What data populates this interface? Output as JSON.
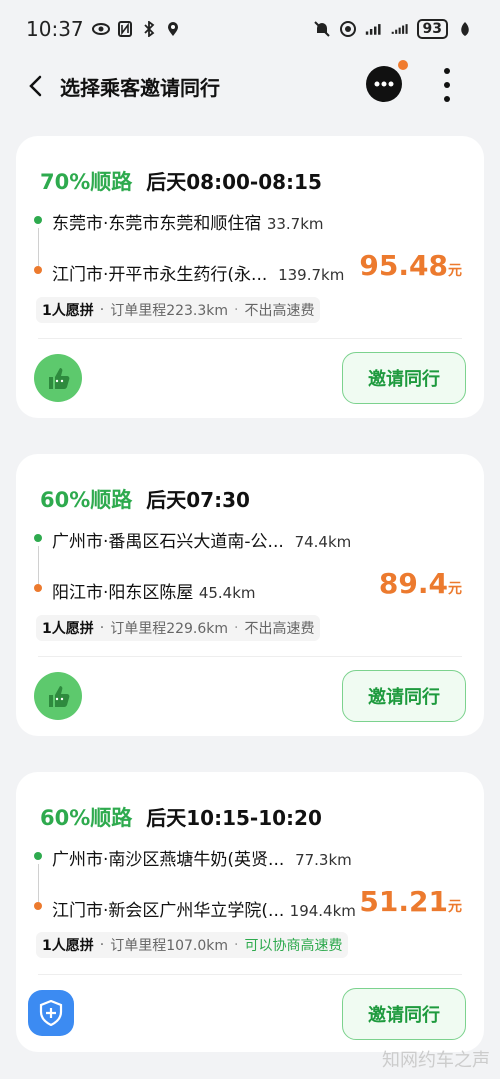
{
  "status": {
    "time": "10:37",
    "battery": "93"
  },
  "header": {
    "title": "选择乘客邀请同行"
  },
  "cards": [
    {
      "match": "70%顺路",
      "time": "后天08:00-08:15",
      "from_addr": "东莞市·东莞市东莞和顺住宿",
      "from_dist": "33.7km",
      "to_addr": "江门市·开平市永生药行(永...",
      "to_dist": "139.7km",
      "price": "95.48",
      "price_unit": "元",
      "riders": "1人愿拼",
      "order_distance": "订单里程223.3km",
      "toll": "不出高速费",
      "invite_label": "邀请同行"
    },
    {
      "match": "60%顺路",
      "time": "后天07:30",
      "from_addr": "广州市·番禺区石兴大道南-公...",
      "from_dist": "74.4km",
      "to_addr": "阳江市·阳东区陈屋",
      "to_dist": "45.4km",
      "price": "89.4",
      "price_unit": "元",
      "riders": "1人愿拼",
      "order_distance": "订单里程229.6km",
      "toll": "不出高速费",
      "invite_label": "邀请同行"
    },
    {
      "match": "60%顺路",
      "time": "后天10:15-10:20",
      "from_addr": "广州市·南沙区燕塘牛奶(英贤...",
      "from_dist": "77.3km",
      "to_addr": "江门市·新会区广州华立学院(...",
      "to_dist": "194.4km",
      "price": "51.21",
      "price_unit": "元",
      "riders": "1人愿拼",
      "order_distance": "订单里程107.0km",
      "toll": "可以协商高速费",
      "invite_label": "邀请同行"
    }
  ],
  "watermark": "知网约车之声",
  "colors": {
    "green": "#2eaa4e",
    "orange": "#ec7a2e",
    "background": "#f2f3f5"
  },
  "icons": [
    "eye-icon",
    "nfc-icon",
    "bluetooth-icon",
    "location-icon",
    "mute-icon",
    "hotspot-icon",
    "signal-icon",
    "back-icon",
    "message-icon",
    "more-icon",
    "thumbs-up-icon",
    "shield-icon"
  ]
}
